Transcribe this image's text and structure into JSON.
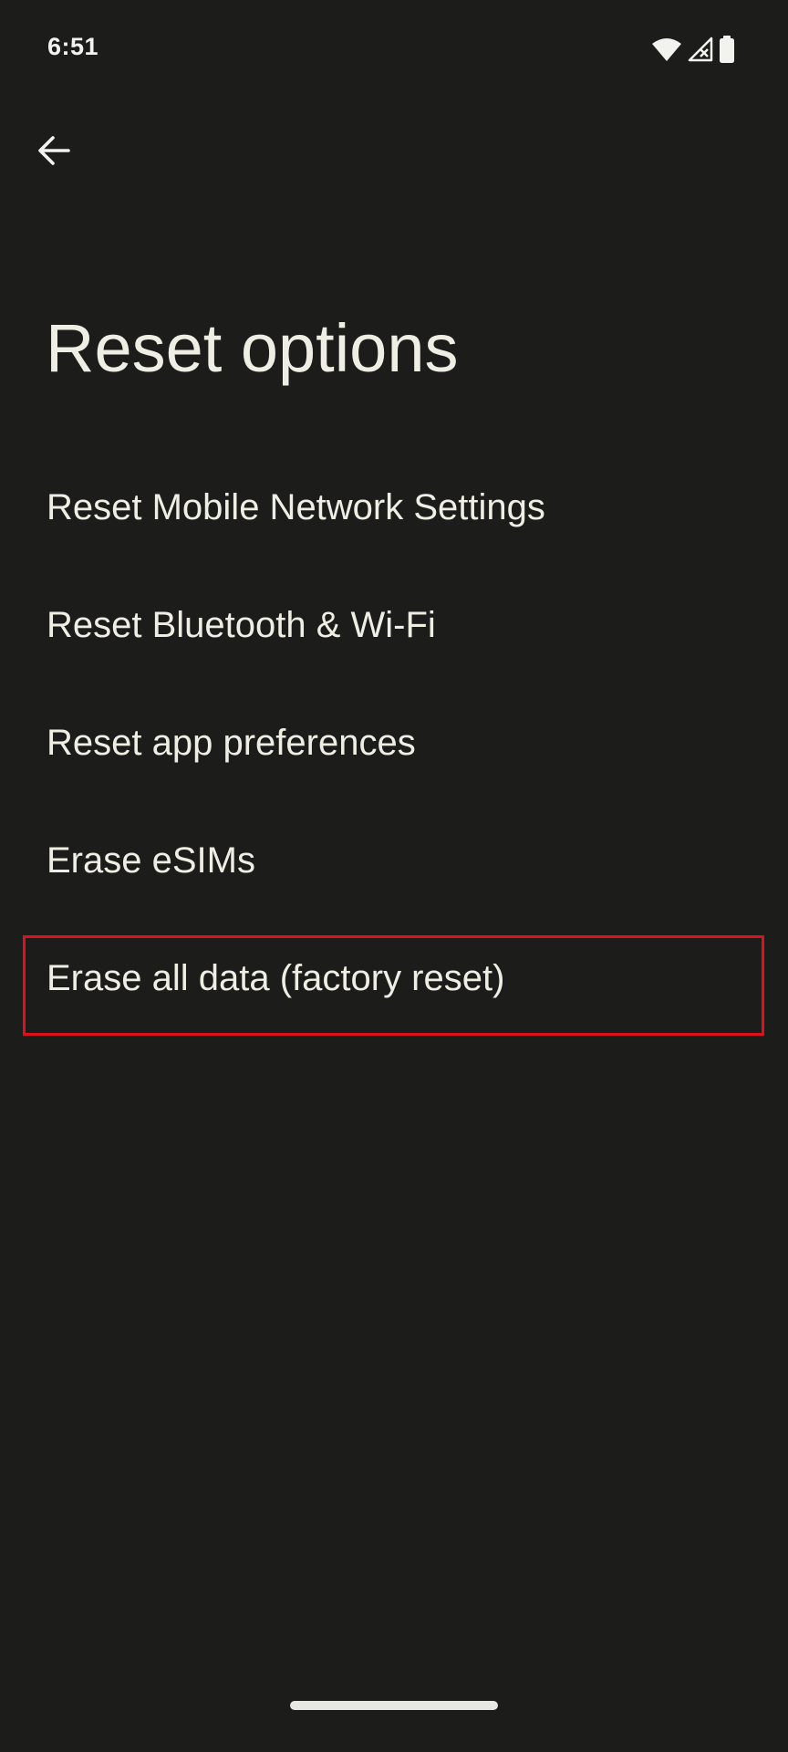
{
  "status_bar": {
    "time": "6:51",
    "icons": [
      "wifi-icon",
      "cellular-no-signal-icon",
      "battery-icon"
    ]
  },
  "toolbar": {
    "back_icon": "arrow-back-icon"
  },
  "page": {
    "title": "Reset options"
  },
  "options": [
    {
      "label": "Reset Mobile Network Settings"
    },
    {
      "label": "Reset Bluetooth & Wi-Fi"
    },
    {
      "label": "Reset app preferences"
    },
    {
      "label": "Erase eSIMs"
    },
    {
      "label": "Erase all data (factory reset)"
    }
  ],
  "colors": {
    "background": "#1c1d1a",
    "text": "#efeee4",
    "highlight_box": "#e0101a"
  }
}
